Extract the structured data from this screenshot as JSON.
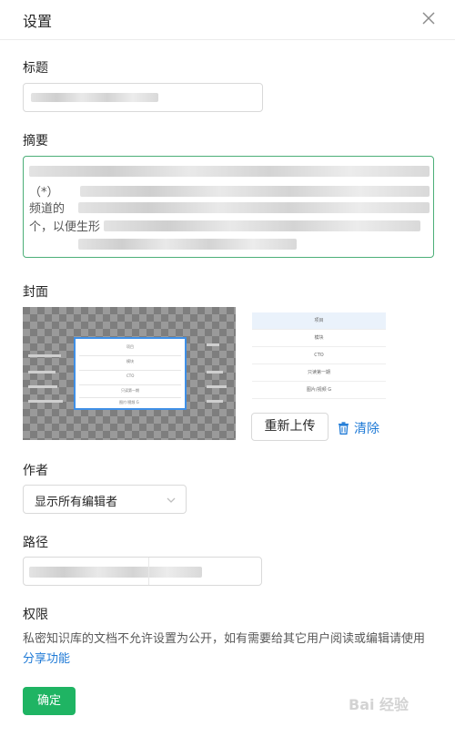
{
  "dialog": {
    "title": "设置",
    "close_icon": "close-icon"
  },
  "fields": {
    "title_label": "标题",
    "summary_label": "摘要",
    "summary_visible_fragments": [
      "频道的",
      "（*）",
      "个，以便生形"
    ],
    "cover_label": "封面",
    "author_label": "作者",
    "path_label": "路径",
    "permission_label": "权限"
  },
  "cover": {
    "preview_items": [
      "项目",
      "模块",
      "CTO",
      "只读第一期",
      "图片/视频 G"
    ],
    "reupload_label": "重新上传",
    "clear_label": "清除",
    "clear_icon": "trash-icon"
  },
  "author": {
    "selected": "显示所有编辑者",
    "arrow_icon": "chevron-down-icon"
  },
  "permission": {
    "text": "私密知识库的文档不允许设置为公开，如有需要给其它用户阅读或编辑请使用 ",
    "link": "分享功能"
  },
  "actions": {
    "confirm_label": "确定"
  },
  "watermark": {
    "text": "Bai 经验"
  },
  "colors": {
    "primary_green": "#1fb463",
    "link_blue": "#1f7ad6",
    "focus_border": "#4caf78"
  }
}
